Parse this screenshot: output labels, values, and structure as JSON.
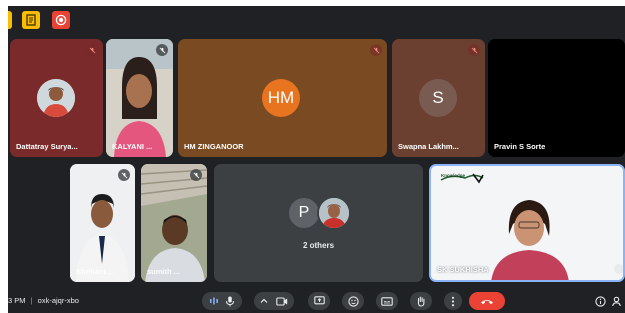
{
  "participants": {
    "dattatray": {
      "name": "Dattatray Surya..."
    },
    "kalyani": {
      "name": "KALYANI ..."
    },
    "hm": {
      "initials": "HM",
      "name": "HM ZINGANOOR"
    },
    "swapna": {
      "initial": "S",
      "name": "Swapna Lakhm..."
    },
    "pravin": {
      "name": "Pravin S Sorte"
    },
    "shrikant": {
      "name": "Shrikant ..."
    },
    "sumith": {
      "name": "sumith ..."
    },
    "others": {
      "initial": "P",
      "label": "2 others"
    },
    "presenter": {
      "name": "SK SUKHISHA",
      "logo_text": "Knowledge"
    }
  },
  "bottom_bar": {
    "time": "3 PM",
    "separator": "|",
    "meeting_code": "oxk-ajqr-xbo"
  },
  "colors": {
    "meet_background": "#202124",
    "dattatray_tile": "#7a2a2a",
    "hm_tile": "#7a4a22",
    "swapna_tile": "#6b4030",
    "hm_avatar": "#e8741f",
    "swapna_avatar": "#7a5b52",
    "others_tile": "#3c4043",
    "end_call": "#ea4335",
    "active_speaker_border": "#8ab4f8"
  },
  "icons": {
    "top_left": [
      "sidebar-edge-icon",
      "files-icon",
      "record-icon"
    ],
    "controls": [
      "audio-level-icon",
      "mic-icon",
      "chevron-up-icon",
      "camera-icon",
      "present-screen-icon",
      "emoji-icon",
      "captions-icon",
      "raise-hand-icon",
      "more-options-icon",
      "end-call-icon"
    ],
    "right": [
      "info-icon",
      "people-icon"
    ]
  }
}
